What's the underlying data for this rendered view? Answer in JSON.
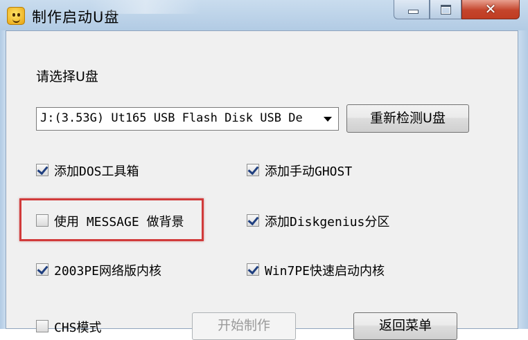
{
  "window": {
    "title": "制作启动U盘",
    "minimize_glyph": "",
    "close_glyph": "✕"
  },
  "usb": {
    "prompt": "请选择U盘",
    "selected_drive": "J:(3.53G) Ut165 USB Flash Disk USB De",
    "detect_button": "重新检测U盘"
  },
  "options": [
    {
      "label": "添加DOS工具箱",
      "checked": true
    },
    {
      "label": "添加手动GHOST",
      "checked": true
    },
    {
      "label": "使用 MESSAGE 做背景",
      "checked": false
    },
    {
      "label": "添加Diskgenius分区",
      "checked": true
    },
    {
      "label": "2003PE网络版内核",
      "checked": true
    },
    {
      "label": "Win7PE快速启动内核",
      "checked": true
    },
    {
      "label": "CHS模式",
      "checked": false
    }
  ],
  "actions": {
    "start_button": "开始制作",
    "back_button": "返回菜单"
  },
  "colors": {
    "highlight_box": "#d13a3a",
    "titlebar": "#c9dcee",
    "close_button": "#c4442b"
  }
}
